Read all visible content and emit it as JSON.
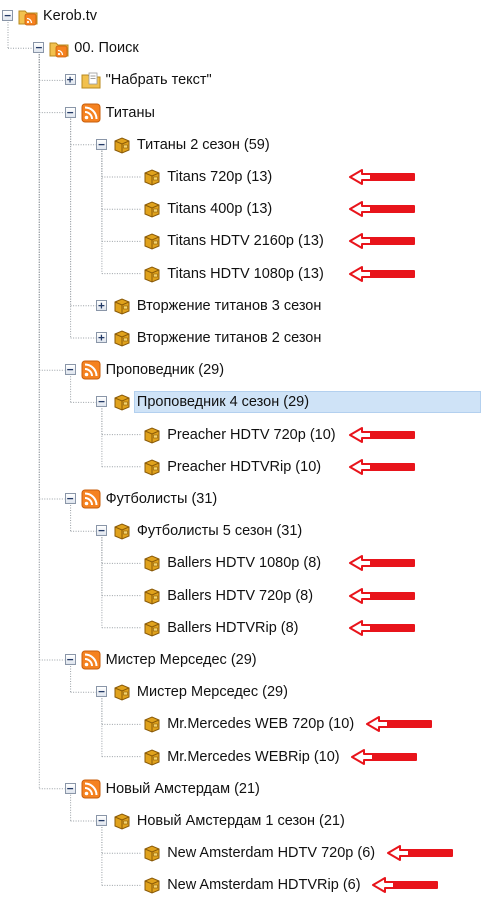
{
  "tree": {
    "nodes": [
      {
        "label": "Kerob.tv",
        "depth": 0,
        "icon": "folder-rss-icon",
        "expander": "minus",
        "arrow": false
      },
      {
        "label": "00. Поиск",
        "depth": 1,
        "icon": "folder-rss-icon",
        "expander": "minus",
        "arrow": false
      },
      {
        "label": "\"Набрать текст\"",
        "depth": 2,
        "icon": "folder-doc-icon",
        "expander": "plus",
        "arrow": false
      },
      {
        "label": "Титаны",
        "depth": 2,
        "icon": "rss-icon",
        "expander": "minus",
        "arrow": false
      },
      {
        "label": "Титаны 2 сезон (59)",
        "depth": 3,
        "icon": "box-icon",
        "expander": "minus",
        "arrow": false
      },
      {
        "label": "Titans  720p (13)",
        "depth": 4,
        "icon": "box-icon",
        "expander": "none",
        "arrow": true
      },
      {
        "label": "Titans  400p (13)",
        "depth": 4,
        "icon": "box-icon",
        "expander": "none",
        "arrow": true
      },
      {
        "label": "Titans  HDTV 2160p (13)",
        "depth": 4,
        "icon": "box-icon",
        "expander": "none",
        "arrow": true
      },
      {
        "label": "Titans  HDTV 1080p (13)",
        "depth": 4,
        "icon": "box-icon",
        "expander": "none",
        "arrow": true
      },
      {
        "label": "Вторжение титанов 3 сезон",
        "depth": 3,
        "icon": "box-icon",
        "expander": "plus",
        "arrow": false
      },
      {
        "label": "Вторжение титанов 2 сезон",
        "depth": 3,
        "icon": "box-icon",
        "expander": "plus",
        "arrow": false
      },
      {
        "label": "Проповедник (29)",
        "depth": 2,
        "icon": "rss-icon",
        "expander": "minus",
        "arrow": false
      },
      {
        "label": "Проповедник 4 сезон (29)",
        "depth": 3,
        "icon": "box-icon",
        "expander": "minus",
        "arrow": false,
        "selected": true
      },
      {
        "label": "Preacher  HDTV 720p (10)",
        "depth": 4,
        "icon": "box-icon",
        "expander": "none",
        "arrow": true
      },
      {
        "label": "Preacher  HDTVRip (10)",
        "depth": 4,
        "icon": "box-icon",
        "expander": "none",
        "arrow": true
      },
      {
        "label": "Футболисты (31)",
        "depth": 2,
        "icon": "rss-icon",
        "expander": "minus",
        "arrow": false
      },
      {
        "label": "Футболисты 5 сезон (31)",
        "depth": 3,
        "icon": "box-icon",
        "expander": "minus",
        "arrow": false
      },
      {
        "label": "Ballers HDTV 1080p (8)",
        "depth": 4,
        "icon": "box-icon",
        "expander": "none",
        "arrow": true
      },
      {
        "label": "Ballers HDTV 720p (8)",
        "depth": 4,
        "icon": "box-icon",
        "expander": "none",
        "arrow": true
      },
      {
        "label": "Ballers HDTVRip (8)",
        "depth": 4,
        "icon": "box-icon",
        "expander": "none",
        "arrow": true
      },
      {
        "label": "Мистер Мерседес (29)",
        "depth": 2,
        "icon": "rss-icon",
        "expander": "minus",
        "arrow": false
      },
      {
        "label": "Мистер Мерседес (29)",
        "depth": 3,
        "icon": "box-icon",
        "expander": "minus",
        "arrow": false
      },
      {
        "label": "Mr.Mercedes WEB 720p (10)",
        "depth": 4,
        "icon": "box-icon",
        "expander": "none",
        "arrow": true
      },
      {
        "label": "Mr.Mercedes WEBRip (10)",
        "depth": 4,
        "icon": "box-icon",
        "expander": "none",
        "arrow": true
      },
      {
        "label": "Новый Амстердам (21)",
        "depth": 2,
        "icon": "rss-icon",
        "expander": "minus",
        "arrow": false
      },
      {
        "label": "Новый Амстердам 1 сезон (21)",
        "depth": 3,
        "icon": "box-icon",
        "expander": "minus",
        "arrow": false
      },
      {
        "label": "New Amsterdam  HDTV 720p (6)",
        "depth": 4,
        "icon": "box-icon",
        "expander": "none",
        "arrow": true
      },
      {
        "label": "New Amsterdam  HDTVRip (6)",
        "depth": 4,
        "icon": "box-icon",
        "expander": "none",
        "arrow": true
      }
    ]
  },
  "colors": {
    "selection": "#cfe3f7",
    "arrow": "#e8141b",
    "rss": "#f58220",
    "folder": "#f2c14e",
    "box": "#e0a21c",
    "tree_lines": "#9aa0a6"
  }
}
